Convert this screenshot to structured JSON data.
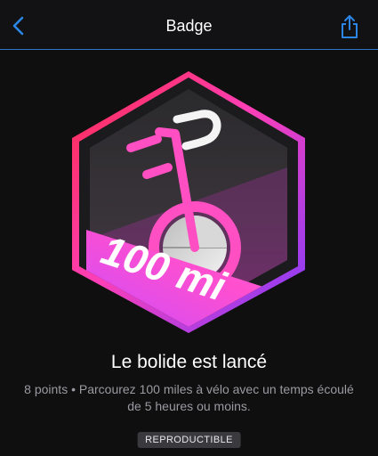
{
  "header": {
    "title": "Badge"
  },
  "badge": {
    "banner_text": "100 mi",
    "title": "Le bolide est lancé",
    "description": "8 points • Parcourez 100 miles à vélo avec un temps écoulé de 5 heures ou moins.",
    "tag": "REPRODUCTIBLE"
  },
  "colors": {
    "accent": "#2b76c9",
    "badge_pink": "#ff3fb7",
    "badge_purple": "#8a44ff"
  },
  "icons": {
    "back": "chevron-left-icon",
    "share": "share-icon",
    "badge": "bicycle-badge-icon"
  }
}
